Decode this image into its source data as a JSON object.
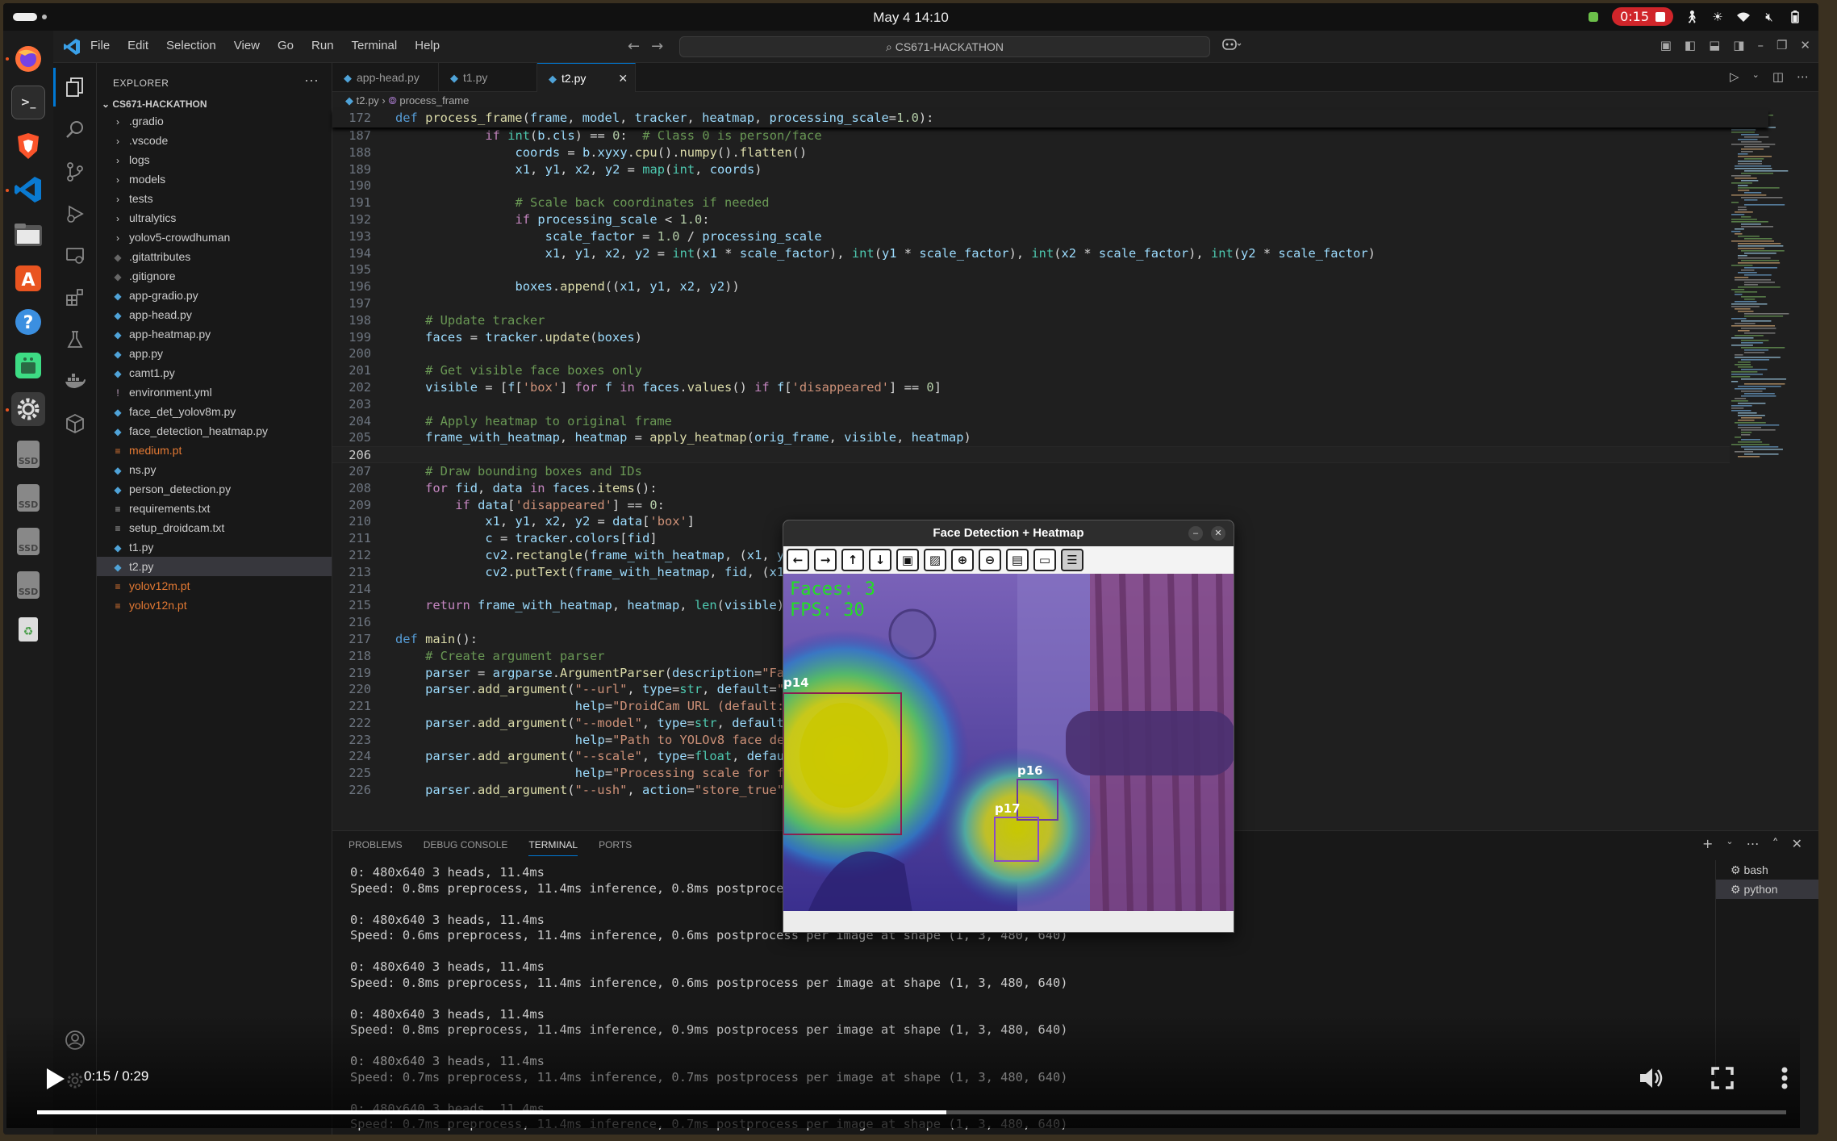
{
  "system": {
    "clock": "May 4  14:10",
    "recording": "0:15"
  },
  "dock": {
    "items": [
      "firefox-icon",
      "terminal-icon",
      "brave-icon",
      "vscode-icon",
      "files-icon",
      "app-center-icon",
      "help-icon",
      "android-studio-icon",
      "settings-icon",
      "ssd-icon",
      "ssd-icon",
      "ssd-icon",
      "ssd-icon",
      "trash-icon"
    ],
    "ssd_label": "SSD"
  },
  "vscode": {
    "menu": [
      "File",
      "Edit",
      "Selection",
      "View",
      "Go",
      "Run",
      "Terminal",
      "Help"
    ],
    "search": "CS671-HACKATHON",
    "explorer": {
      "title": "EXPLORER",
      "project": "CS671-HACKATHON",
      "items": [
        {
          "name": ".gradio",
          "kind": "folder"
        },
        {
          "name": ".vscode",
          "kind": "folder"
        },
        {
          "name": "logs",
          "kind": "folder"
        },
        {
          "name": "models",
          "kind": "folder"
        },
        {
          "name": "tests",
          "kind": "folder"
        },
        {
          "name": "ultralytics",
          "kind": "folder"
        },
        {
          "name": "yolov5-crowdhuman",
          "kind": "folder"
        },
        {
          "name": ".gitattributes",
          "kind": "git"
        },
        {
          "name": ".gitignore",
          "kind": "git"
        },
        {
          "name": "app-gradio.py",
          "kind": "py"
        },
        {
          "name": "app-head.py",
          "kind": "py"
        },
        {
          "name": "app-heatmap.py",
          "kind": "py"
        },
        {
          "name": "app.py",
          "kind": "py"
        },
        {
          "name": "camt1.py",
          "kind": "py"
        },
        {
          "name": "environment.yml",
          "kind": "yml"
        },
        {
          "name": "face_det_yolov8m.py",
          "kind": "py"
        },
        {
          "name": "face_detection_heatmap.py",
          "kind": "py"
        },
        {
          "name": "medium.pt",
          "kind": "pt"
        },
        {
          "name": "ns.py",
          "kind": "py"
        },
        {
          "name": "person_detection.py",
          "kind": "py"
        },
        {
          "name": "requirements.txt",
          "kind": "txt"
        },
        {
          "name": "setup_droidcam.txt",
          "kind": "txt"
        },
        {
          "name": "t1.py",
          "kind": "py"
        },
        {
          "name": "t2.py",
          "kind": "py",
          "selected": true
        },
        {
          "name": "yolov12m.pt",
          "kind": "pt"
        },
        {
          "name": "yolov12n.pt",
          "kind": "pt"
        }
      ]
    },
    "tabs": [
      {
        "label": "app-head.py",
        "active": false
      },
      {
        "label": "t1.py",
        "active": false
      },
      {
        "label": "t2.py",
        "active": true
      }
    ],
    "breadcrumb": {
      "file": "t2.py",
      "symbol": "process_frame"
    },
    "sticky_line": {
      "num": "172",
      "text": "def process_frame(frame, model, tracker, heatmap, processing_scale=1.0):"
    },
    "current_line": "206",
    "code": [
      {
        "n": "187",
        "t": "            if int(b.cls) == 0:  # Class 0 is person/face"
      },
      {
        "n": "188",
        "t": "                coords = b.xyxy.cpu().numpy().flatten()"
      },
      {
        "n": "189",
        "t": "                x1, y1, x2, y2 = map(int, coords)"
      },
      {
        "n": "190",
        "t": ""
      },
      {
        "n": "191",
        "t": "                # Scale back coordinates if needed"
      },
      {
        "n": "192",
        "t": "                if processing_scale < 1.0:"
      },
      {
        "n": "193",
        "t": "                    scale_factor = 1.0 / processing_scale"
      },
      {
        "n": "194",
        "t": "                    x1, y1, x2, y2 = int(x1 * scale_factor), int(y1 * scale_factor), int(x2 * scale_factor), int(y2 * scale_factor)"
      },
      {
        "n": "195",
        "t": ""
      },
      {
        "n": "196",
        "t": "                boxes.append((x1, y1, x2, y2))"
      },
      {
        "n": "197",
        "t": ""
      },
      {
        "n": "198",
        "t": "    # Update tracker"
      },
      {
        "n": "199",
        "t": "    faces = tracker.update(boxes)"
      },
      {
        "n": "200",
        "t": ""
      },
      {
        "n": "201",
        "t": "    # Get visible face boxes only"
      },
      {
        "n": "202",
        "t": "    visible = [f['box'] for f in faces.values() if f['disappeared'] == 0]"
      },
      {
        "n": "203",
        "t": ""
      },
      {
        "n": "204",
        "t": "    # Apply heatmap to original frame"
      },
      {
        "n": "205",
        "t": "    frame_with_heatmap, heatmap = apply_heatmap(orig_frame, visible, heatmap)"
      },
      {
        "n": "206",
        "t": ""
      },
      {
        "n": "207",
        "t": "    # Draw bounding boxes and IDs"
      },
      {
        "n": "208",
        "t": "    for fid, data in faces.items():"
      },
      {
        "n": "209",
        "t": "        if data['disappeared'] == 0:"
      },
      {
        "n": "210",
        "t": "            x1, y1, x2, y2 = data['box']"
      },
      {
        "n": "211",
        "t": "            c = tracker.colors[fid]"
      },
      {
        "n": "212",
        "t": "            cv2.rectangle(frame_with_heatmap, (x1, y1), (x2, y2), c, 2)"
      },
      {
        "n": "213",
        "t": "            cv2.putText(frame_with_heatmap, fid, (x1, y1-10), cv2.FONT_HERSHEY_SIMPLEX, 0.6, c, 2)"
      },
      {
        "n": "214",
        "t": ""
      },
      {
        "n": "215",
        "t": "    return frame_with_heatmap, heatmap, len(visible)"
      },
      {
        "n": "216",
        "t": ""
      },
      {
        "n": "217",
        "t": "def main():"
      },
      {
        "n": "218",
        "t": "    # Create argument parser"
      },
      {
        "n": "219",
        "t": "    parser = argparse.ArgumentParser(description=\"Face Detection with Heatmap\")"
      },
      {
        "n": "220",
        "t": "    parser.add_argument(\"--url\", type=str, default=\"http://"
      },
      {
        "n": "221",
        "t": "                        help=\"DroidCam URL (default: http://"
      },
      {
        "n": "222",
        "t": "    parser.add_argument(\"--model\", type=str, default=\"medium"
      },
      {
        "n": "223",
        "t": "                        help=\"Path to YOLOv8 face detection"
      },
      {
        "n": "224",
        "t": "    parser.add_argument(\"--scale\", type=float, default=1.0,"
      },
      {
        "n": "225",
        "t": "                        help=\"Processing scale for faster p"
      },
      {
        "n": "226",
        "t": "    parser.add_argument(\"--ush\", action=\"store_true\","
      }
    ],
    "panel": {
      "tabs": [
        "PROBLEMS",
        "DEBUG CONSOLE",
        "TERMINAL",
        "PORTS"
      ],
      "active_tab": "TERMINAL",
      "terminals": [
        "bash",
        "python"
      ],
      "active_terminal": "python",
      "output": [
        "0: 480x640 3 heads, 11.4ms",
        "Speed: 0.8ms preprocess, 11.4ms inference, 0.8ms postprocess per image at shape (1, 3, 480, 640)",
        "",
        "0: 480x640 3 heads, 11.4ms",
        "Speed: 0.6ms preprocess, 11.4ms inference, 0.6ms postprocess per image at shape (1, 3, 480, 640)",
        "",
        "0: 480x640 3 heads, 11.4ms",
        "Speed: 0.8ms preprocess, 11.4ms inference, 0.6ms postprocess per image at shape (1, 3, 480, 640)",
        "",
        "0: 480x640 3 heads, 11.4ms",
        "Speed: 0.8ms preprocess, 11.4ms inference, 0.9ms postprocess per image at shape (1, 3, 480, 640)",
        "",
        "0: 480x640 3 heads, 11.4ms",
        "Speed: 0.7ms preprocess, 11.4ms inference, 0.7ms postprocess per image at shape (1, 3, 480, 640)",
        "",
        "0: 480x640 3 heads, 11.4ms",
        "Speed: 0.7ms preprocess, 11.4ms inference, 0.7ms postprocess per image at shape (1, 3, 480, 640)"
      ]
    }
  },
  "cv_window": {
    "title": "Face Detection + Heatmap",
    "toolbar": [
      "arrow-left-icon",
      "arrow-right-icon",
      "arrow-up-icon",
      "arrow-down-icon",
      "zoom-fit-icon",
      "zoom-image-icon",
      "zoom-in-icon",
      "zoom-out-icon",
      "save-icon",
      "copy-icon",
      "properties-icon"
    ],
    "overlay": {
      "faces": "Faces: 3",
      "fps": "FPS: 30"
    },
    "labels": {
      "p14": "p14",
      "p16": "p16",
      "p17": "p17"
    }
  },
  "video": {
    "time": "0:15 / 0:29",
    "progress": 0.52
  }
}
